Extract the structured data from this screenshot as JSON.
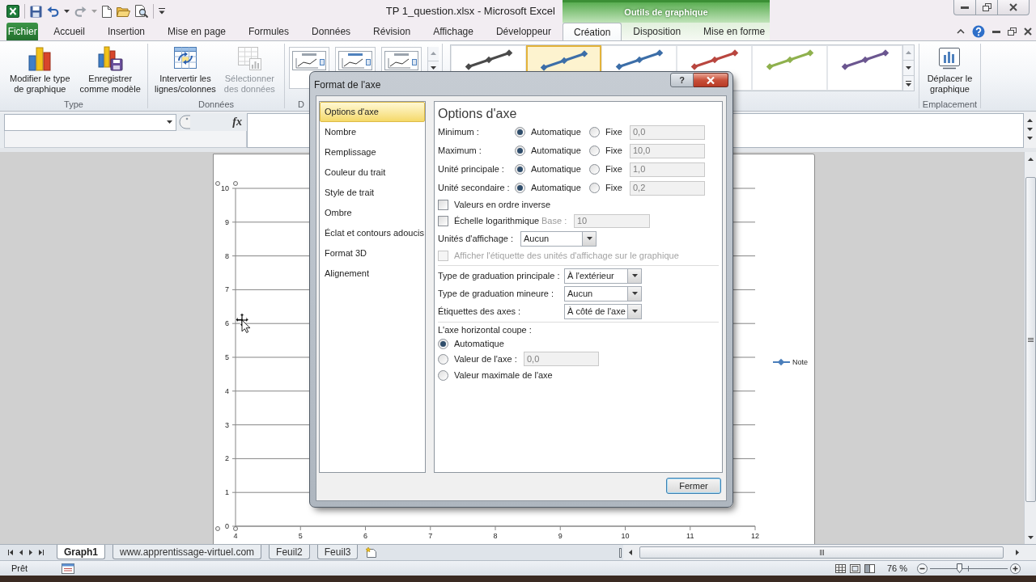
{
  "window": {
    "title": "TP 1_question.xlsx - Microsoft Excel",
    "context_title": "Outils de graphique"
  },
  "ribbon_tabs": [
    {
      "label": "Fichier",
      "kind": "file",
      "selected": false
    },
    {
      "label": "Accueil",
      "kind": "standard",
      "selected": false
    },
    {
      "label": "Insertion",
      "kind": "standard",
      "selected": false
    },
    {
      "label": "Mise en page",
      "kind": "standard",
      "selected": false
    },
    {
      "label": "Formules",
      "kind": "standard",
      "selected": false
    },
    {
      "label": "Données",
      "kind": "standard",
      "selected": false
    },
    {
      "label": "Révision",
      "kind": "standard",
      "selected": false
    },
    {
      "label": "Affichage",
      "kind": "standard",
      "selected": false
    },
    {
      "label": "Développeur",
      "kind": "standard",
      "selected": false
    },
    {
      "label": "Création",
      "kind": "contextual",
      "selected": true
    },
    {
      "label": "Disposition",
      "kind": "contextual",
      "selected": false
    },
    {
      "label": "Mise en forme",
      "kind": "contextual",
      "selected": false
    }
  ],
  "ribbon": {
    "groups": [
      {
        "kind": "buttons",
        "label": "Type",
        "buttons": [
          {
            "kind": "charttype",
            "lines": [
              "Modifier le type",
              "de graphique"
            ],
            "disabled": false
          },
          {
            "kind": "template",
            "lines": [
              "Enregistrer",
              "comme modèle"
            ],
            "disabled": false
          }
        ]
      },
      {
        "kind": "buttons",
        "label": "Données",
        "buttons": [
          {
            "kind": "switch",
            "lines": [
              "Intervertir les",
              "lignes/colonnes"
            ],
            "disabled": false
          },
          {
            "kind": "select",
            "lines": [
              "Sélectionner",
              "des données"
            ],
            "disabled": true
          }
        ]
      },
      {
        "kind": "layouts",
        "label": "D"
      },
      {
        "kind": "styles",
        "styles": [
          {
            "color": "#4a4a4a",
            "selected": false
          },
          {
            "color": "#3c6ea8",
            "selected": true
          },
          {
            "color": "#3c6ea8",
            "selected": false
          },
          {
            "color": "#b9463f",
            "selected": false
          },
          {
            "color": "#8fb14e",
            "selected": false
          },
          {
            "color": "#6b5690",
            "selected": false
          }
        ]
      },
      {
        "kind": "buttons",
        "label": "Emplacement",
        "buttons": [
          {
            "kind": "move",
            "lines": [
              "Déplacer le",
              "graphique"
            ],
            "disabled": false
          }
        ]
      }
    ]
  },
  "formula_bar": {
    "function_label": "fx"
  },
  "chart": {
    "chart_data": {
      "type": "line",
      "grid": true,
      "categories": [
        "4",
        "5",
        "6",
        "7",
        "8",
        "9",
        "10",
        "11",
        "12"
      ],
      "ylim": [
        0,
        10
      ],
      "yticks": [
        0,
        1,
        2,
        3,
        4,
        5,
        6,
        7,
        8,
        9,
        10
      ],
      "series": [
        {
          "name": "Note",
          "color": "#4a7ebb",
          "values": [
            null,
            null,
            null,
            null,
            null,
            null,
            null,
            null,
            null
          ]
        }
      ]
    }
  },
  "dialog": {
    "title": "Format de l'axe",
    "help_label": "?",
    "categories": [
      {
        "label": "Options d'axe",
        "selected": true
      },
      {
        "label": "Nombre",
        "selected": false
      },
      {
        "label": "Remplissage",
        "selected": false
      },
      {
        "label": "Couleur du trait",
        "selected": false
      },
      {
        "label": "Style de trait",
        "selected": false
      },
      {
        "label": "Ombre",
        "selected": false
      },
      {
        "label": "Éclat et contours adoucis",
        "selected": false
      },
      {
        "label": "Format 3D",
        "selected": false
      },
      {
        "label": "Alignement",
        "selected": false
      }
    ],
    "panel_title": "Options d'axe",
    "bounds": [
      {
        "label": "Minimum :",
        "auto_label": "Automatique",
        "fixed_label": "Fixe",
        "auto": true,
        "value": "0,0"
      },
      {
        "label": "Maximum :",
        "auto_label": "Automatique",
        "fixed_label": "Fixe",
        "auto": true,
        "value": "10,0"
      },
      {
        "label": "Unité principale :",
        "auto_label": "Automatique",
        "fixed_label": "Fixe",
        "auto": true,
        "value": "1,0"
      },
      {
        "label": "Unité secondaire :",
        "auto_label": "Automatique",
        "fixed_label": "Fixe",
        "auto": true,
        "value": "0,2"
      }
    ],
    "reverse_order": {
      "label": "Valeurs en ordre inverse",
      "checked": false
    },
    "log_scale": {
      "label": "Échelle logarithmique",
      "checked": false,
      "base_label": "Base :",
      "base_value": "10"
    },
    "display_units": {
      "label": "Unités d'affichage :",
      "value": "Aucun"
    },
    "show_units_label": {
      "label": "Afficher l'étiquette des unités d'affichage sur le graphique",
      "checked": false,
      "disabled": true
    },
    "tick_settings": [
      {
        "label": "Type de graduation principale :",
        "value": "À l'extérieur"
      },
      {
        "label": "Type de graduation mineure :",
        "value": "Aucun"
      },
      {
        "label": "Étiquettes des axes :",
        "value": "À côté de l'axe"
      }
    ],
    "crossing": {
      "label": "L'axe horizontal coupe :",
      "options": [
        {
          "kind": "plain",
          "label": "Automatique",
          "selected": true
        },
        {
          "kind": "value",
          "label": "Valeur de l'axe :",
          "selected": false,
          "value": "0,0"
        },
        {
          "kind": "plain",
          "label": "Valeur maximale de l'axe",
          "selected": false
        }
      ]
    },
    "close_button": "Fermer"
  },
  "sheet_tabs": [
    {
      "label": "Graph1",
      "selected": true
    },
    {
      "label": "www.apprentissage-virtuel.com",
      "selected": false
    },
    {
      "label": "Feuil2",
      "selected": false
    },
    {
      "label": "Feuil3",
      "selected": false
    }
  ],
  "status_bar": {
    "status": "Prêt",
    "zoom": "76 %",
    "zoom_slider": {
      "level": 0.37
    }
  }
}
